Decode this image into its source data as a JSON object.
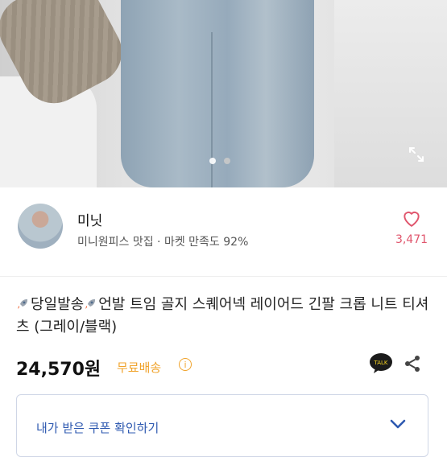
{
  "hero": {
    "dots_total": 2,
    "dots_active_index": 0,
    "expand_icon": "expand-icon"
  },
  "seller": {
    "name": "미닛",
    "subtitle": "미니원피스 맛집 · 마켓 만족도 92%",
    "likes": "3,471",
    "heart_icon": "heart-outline-icon",
    "heart_color": "#e0566d"
  },
  "product": {
    "title_part1": "당일발송",
    "title_part2": "언발 트임 골지 스퀘어넥 레이어드 긴팔 크롭 니트 티셔츠 (그레이/블랙)",
    "price": "24,570원",
    "shipping": "무료배송",
    "info_symbol": "i",
    "shipping_color": "#f0a32b",
    "talk_label": "TALK"
  },
  "coupon": {
    "label": "내가 받은 쿠폰 확인하기",
    "accent_color": "#2e59b0"
  }
}
